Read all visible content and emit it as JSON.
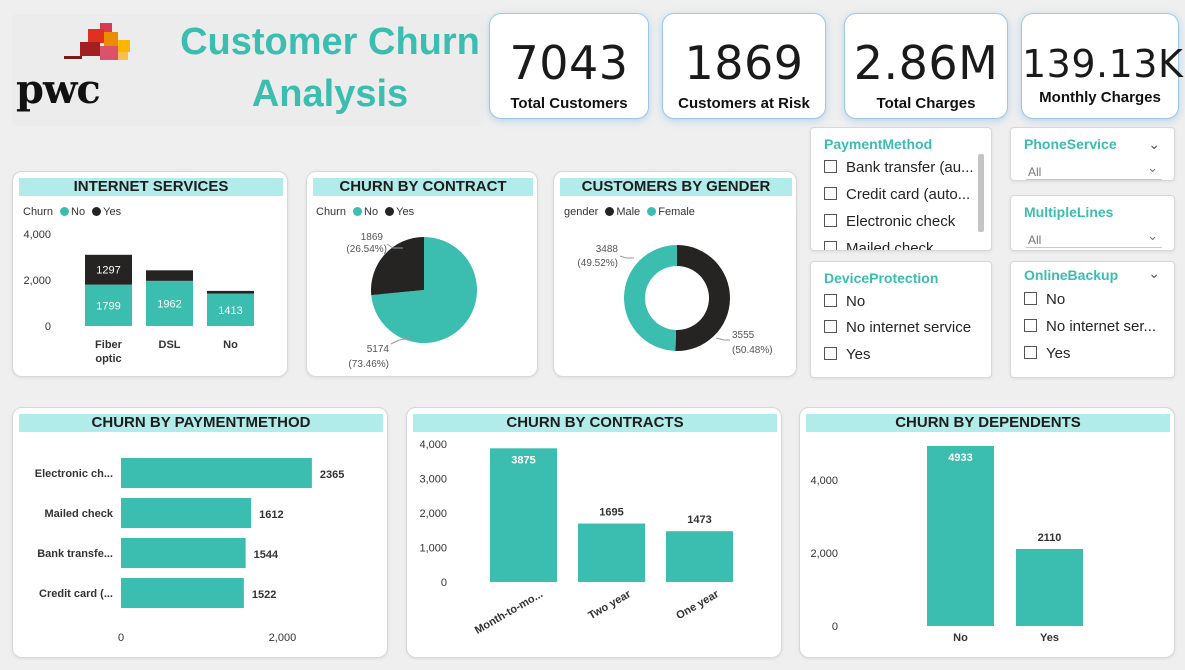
{
  "header": {
    "title_line1": "Customer Churn",
    "title_line2": "Analysis",
    "logo_text": "pwc"
  },
  "kpis": [
    {
      "value": "7043",
      "label": "Total Customers"
    },
    {
      "value": "1869",
      "label": "Customers at Risk"
    },
    {
      "value": "2.86M",
      "label": "Total Charges"
    },
    {
      "value": "139.13K",
      "label": "Monthly Charges"
    }
  ],
  "colors": {
    "teal": "#3bbdb0",
    "dark": "#252423",
    "title_bg": "#b2ecea",
    "slicer_title": "#3bbdb0"
  },
  "slicers": {
    "payment_method": {
      "title": "PaymentMethod",
      "items": [
        "Bank transfer (au...",
        "Credit card (auto...",
        "Electronic check",
        "Mailed check"
      ]
    },
    "phone_service": {
      "title": "PhoneService",
      "value": "All"
    },
    "multiple_lines": {
      "title": "MultipleLines",
      "value": "All"
    },
    "device_protection": {
      "title": "DeviceProtection",
      "items": [
        "No",
        "No internet service",
        "Yes"
      ]
    },
    "online_backup": {
      "title": "OnlineBackup",
      "items": [
        "No",
        "No internet ser...",
        "Yes"
      ]
    }
  },
  "chart_data": [
    {
      "id": "internet",
      "type": "bar",
      "title": "INTERNET SERVICES",
      "legend_title": "Churn",
      "categories": [
        "Fiber optic",
        "DSL",
        "No"
      ],
      "series": [
        {
          "name": "No",
          "values": [
            1799,
            1962,
            1413
          ]
        },
        {
          "name": "Yes",
          "values": [
            1297,
            459,
            113
          ]
        }
      ],
      "data_labels": {
        "No": [
          "1799",
          "1962",
          "1413"
        ],
        "Yes": [
          "1297",
          "",
          ""
        ]
      },
      "ylim": [
        0,
        4000
      ],
      "yticks": [
        "4,000",
        "2,000",
        "0"
      ],
      "stacked": true
    },
    {
      "id": "contract_pie",
      "type": "pie",
      "title": "CHURN BY CONTRACT",
      "legend_title": "Churn",
      "labels": [
        "No",
        "Yes"
      ],
      "values": [
        5174,
        1869
      ],
      "percent_labels": [
        "(73.46%)",
        "(26.54%)"
      ]
    },
    {
      "id": "gender_donut",
      "type": "pie",
      "title": "CUSTOMERS BY GENDER",
      "legend_title": "gender",
      "labels": [
        "Male",
        "Female"
      ],
      "values": [
        3555,
        3488
      ],
      "percent_labels": [
        "(50.48%)",
        "(49.52%)"
      ]
    },
    {
      "id": "paymethod",
      "type": "bar",
      "orientation": "horizontal",
      "title": "CHURN BY PAYMENTMETHOD",
      "categories": [
        "Electronic ch...",
        "Mailed check",
        "Bank transfe...",
        "Credit card (..."
      ],
      "values": [
        2365,
        1612,
        1544,
        1522
      ],
      "xticks": [
        "0",
        "2,000"
      ]
    },
    {
      "id": "contracts",
      "type": "bar",
      "title": "CHURN BY CONTRACTS",
      "categories": [
        "Month-to-mo...",
        "Two year",
        "One year"
      ],
      "values": [
        3875,
        1695,
        1473
      ],
      "ylim": [
        0,
        4000
      ],
      "yticks": [
        "4,000",
        "3,000",
        "2,000",
        "1,000",
        "0"
      ]
    },
    {
      "id": "dependents",
      "type": "bar",
      "title": "CHURN BY DEPENDENTS",
      "categories": [
        "No",
        "Yes"
      ],
      "values": [
        4933,
        2110
      ],
      "ylim": [
        0,
        6000
      ],
      "yticks": [
        "4,000",
        "2,000",
        "0"
      ]
    }
  ]
}
